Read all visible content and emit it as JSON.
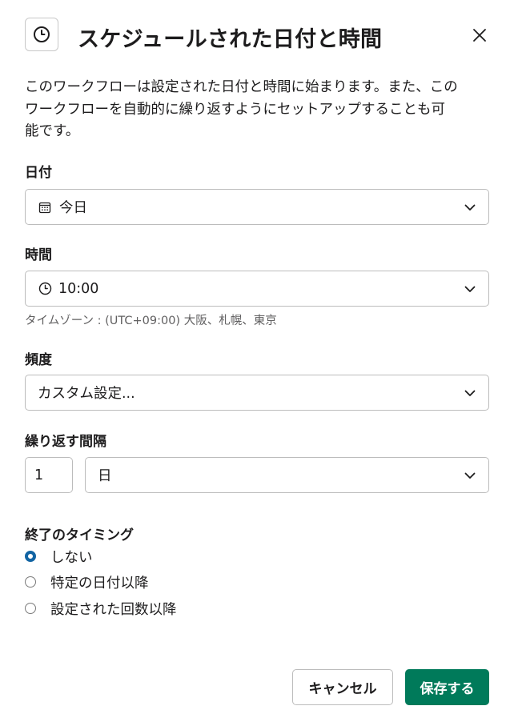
{
  "header": {
    "title": "スケジュールされた日付と時間",
    "icon": "clock-icon",
    "close_icon": "close-icon"
  },
  "description_lines": [
    "このワークフローは設定された日付と時間に始まります。また、この",
    "ワークフローを自動的に繰り返すようにセットアップすることも可",
    "能です。"
  ],
  "date": {
    "label": "日付",
    "value": "今日",
    "icon": "calendar-icon"
  },
  "time": {
    "label": "時間",
    "value": "10:00",
    "icon": "clock-icon",
    "timezone_hint": "タイムゾーン : (UTC+09:00) 大阪、札幌、東京"
  },
  "frequency": {
    "label": "頻度",
    "value": "カスタム設定..."
  },
  "interval": {
    "label": "繰り返す間隔",
    "number": "1",
    "unit": "日"
  },
  "end_timing": {
    "label": "終了のタイミング",
    "options": [
      {
        "label": "しない",
        "checked": true
      },
      {
        "label": "特定の日付以降",
        "checked": false
      },
      {
        "label": "設定された回数以降",
        "checked": false
      }
    ]
  },
  "buttons": {
    "cancel": "キャンセル",
    "save": "保存する"
  },
  "colors": {
    "primary": "#007a5a",
    "radio_selected": "#1264a3",
    "text": "#1d1c1d",
    "muted": "#616061",
    "border": "#bcbcbc"
  }
}
